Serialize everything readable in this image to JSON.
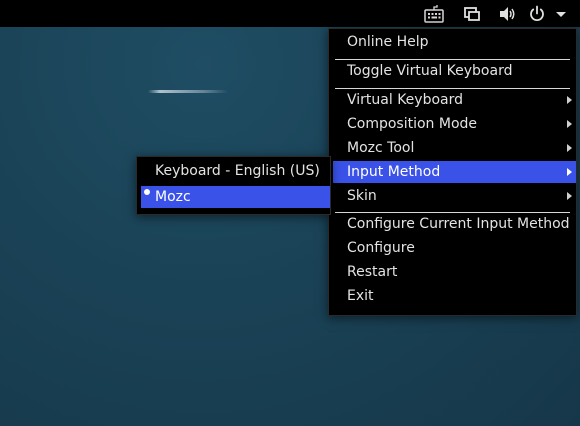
{
  "tray": {
    "icons": [
      "keyboard-icon",
      "windows-icon",
      "volume-icon",
      "power-icon",
      "dropdown-arrow-icon"
    ]
  },
  "main_menu": {
    "items": [
      {
        "label": "Online Help"
      },
      {
        "label": "Toggle Virtual Keyboard"
      },
      {
        "label": "Virtual Keyboard",
        "submenu": true
      },
      {
        "label": "Composition Mode",
        "submenu": true
      },
      {
        "label": "Mozc Tool",
        "submenu": true
      },
      {
        "label": "Input Method",
        "submenu": true,
        "active": true
      },
      {
        "label": "Skin",
        "submenu": true
      },
      {
        "label": "Configure Current Input Method"
      },
      {
        "label": "Configure"
      },
      {
        "label": "Restart"
      },
      {
        "label": "Exit"
      }
    ]
  },
  "input_method_submenu": {
    "items": [
      {
        "label": "Keyboard - English (US)",
        "selected": false
      },
      {
        "label": "Mozc",
        "selected": true,
        "active": true
      }
    ]
  },
  "colors": {
    "menu_bg": "#000000",
    "highlight": "#3a52e8",
    "text": "#e3e3e3"
  }
}
